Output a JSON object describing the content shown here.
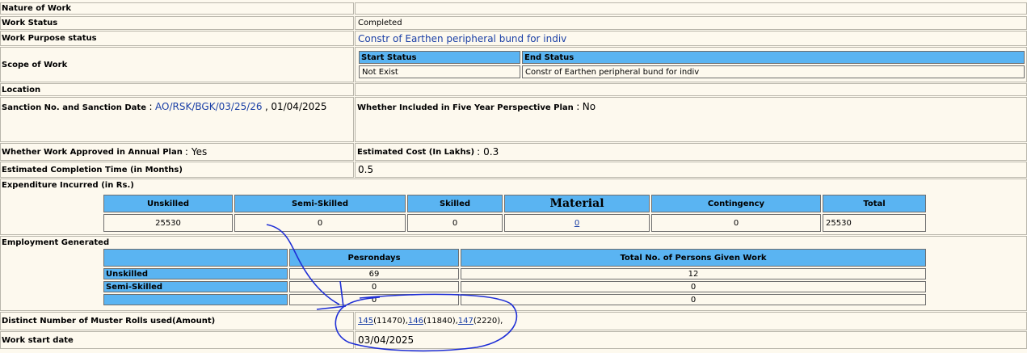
{
  "rows": {
    "nature_of_work": {
      "label": "Nature of Work",
      "value": ""
    },
    "work_status": {
      "label": "Work Status",
      "value": "Completed"
    },
    "work_purpose": {
      "label": "Work Purpose status",
      "value": "Constr of Earthen peripheral bund for indiv"
    },
    "scope": {
      "label": "Scope of Work",
      "start_header": "Start Status",
      "end_header": "End Status",
      "start_value": "Not Exist",
      "end_value": "Constr of Earthen peripheral bund for indiv"
    },
    "location": {
      "label": "Location",
      "value": ""
    },
    "sanction": {
      "label": "Sanction No. and Sanction Date",
      "colon": ":",
      "number": "AO/RSK/BGK/03/25/26",
      "comma": ",",
      "date": "01/04/2025"
    },
    "five_year": {
      "label": "Whether Included in Five Year Perspective Plan",
      "colon": ":",
      "value": "No"
    },
    "annual_plan": {
      "label": "Whether Work Approved in Annual Plan",
      "colon": ":",
      "value": "Yes"
    },
    "estimated_cost": {
      "label": "Estimated Cost (In Lakhs)",
      "colon": ":",
      "value": "0.3"
    },
    "completion_time": {
      "label": "Estimated Completion Time (in Months)",
      "value": "0.5"
    },
    "expenditure": {
      "label": "Expenditure Incurred (in Rs.)",
      "headers": [
        "Unskilled",
        "Semi-Skilled",
        "Skilled",
        "Material",
        "Contingency",
        "Total"
      ],
      "values": [
        "25530",
        "0",
        "0",
        "0",
        "0",
        "25530"
      ]
    },
    "employment": {
      "label": "Employment Generated",
      "headers": [
        "",
        "Pesrondays",
        "Total No. of Persons Given Work"
      ],
      "rows": [
        {
          "type": "Unskilled",
          "persondays": "69",
          "persons": "12"
        },
        {
          "type": "Semi-Skilled",
          "persondays": "0",
          "persons": "0"
        },
        {
          "type": "",
          "persondays": "0",
          "persons": "0"
        }
      ]
    },
    "muster": {
      "label": "Distinct Number of Muster Rolls used(Amount)",
      "items": [
        {
          "roll": "145",
          "amount": "(11470),"
        },
        {
          "roll": "146",
          "amount": "(11840),"
        },
        {
          "roll": "147",
          "amount": "(2220),"
        }
      ]
    },
    "start_date": {
      "label": "Work start date",
      "value": "03/04/2025"
    }
  },
  "colors": {
    "page_bg": "#fdf9ee",
    "header_blue": "#5ab4f2",
    "link_blue": "#1a3fa6",
    "ink_annotation": "#1f2fd6"
  }
}
